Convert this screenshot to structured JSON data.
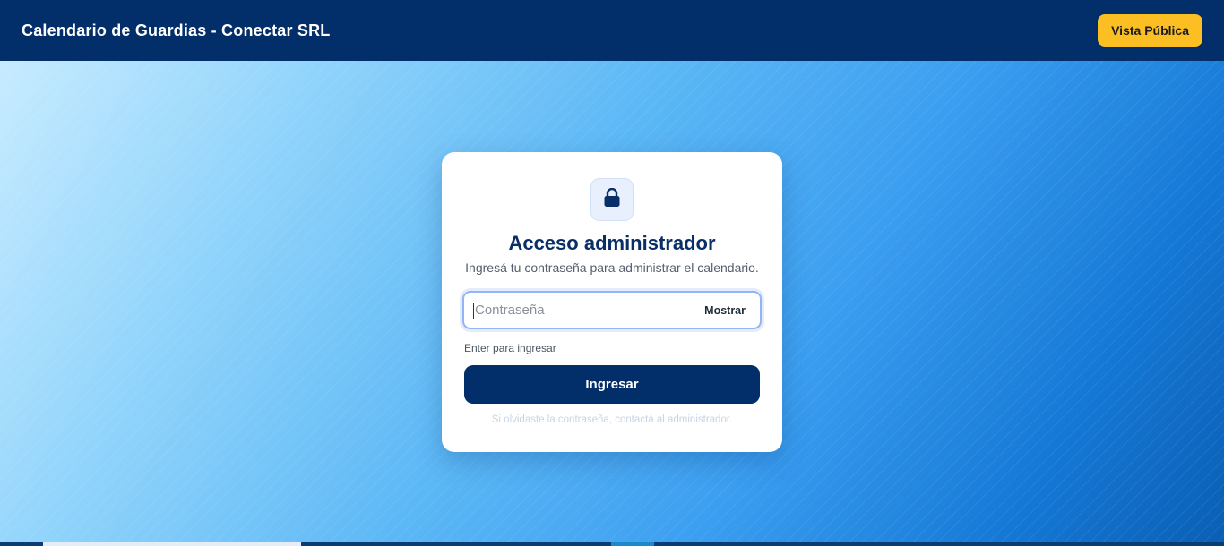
{
  "header": {
    "title": "Calendario de Guardias - Conectar SRL",
    "public_view_label": "Vista Pública"
  },
  "login": {
    "icon": "lock-icon",
    "title": "Acceso administrador",
    "subtitle": "Ingresá tu contraseña para administrar el calendario.",
    "password_placeholder": "Contraseña",
    "password_value": "",
    "show_label": "Mostrar",
    "hint": "Enter para ingresar",
    "submit_label": "Ingresar",
    "forgot_text": "Si olvidaste la contraseña, contactá al administrador."
  },
  "colors": {
    "header_bg": "#022f6a",
    "accent_button": "#fbbf24",
    "primary_button": "#022f6a",
    "title_text": "#0a2f66"
  }
}
